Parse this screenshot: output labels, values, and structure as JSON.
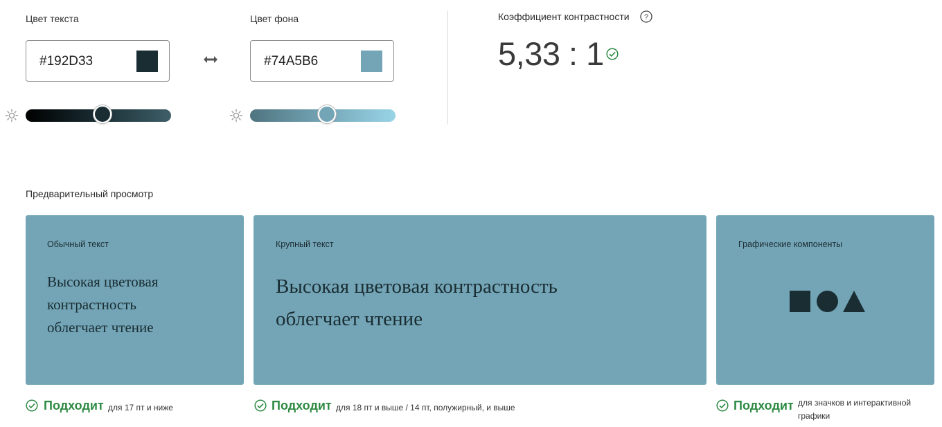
{
  "text_color": {
    "label": "Цвет текста",
    "value": "#192D33",
    "swatch": "#192D33",
    "brightness": 0.5
  },
  "swap_icon": "swap-horizontal-icon",
  "bg_color": {
    "label": "Цвет фона",
    "value": "#74A5B6",
    "swatch": "#74A5B6",
    "brightness": 0.53
  },
  "contrast": {
    "label": "Коэффициент контрастности",
    "ratio": "5,33 : 1",
    "status_color": "#2d8a43"
  },
  "preview": {
    "heading": "Предварительный просмотр",
    "normal": {
      "category": "Обычный текст",
      "line1": "Высокая цветовая",
      "line2": "контрастность",
      "line3": "облегчает чтение"
    },
    "large": {
      "category": "Крупный текст",
      "line1": "Высокая цветовая контрастность",
      "line2": "облегчает чтение"
    },
    "graphics": {
      "category": "Графические компоненты",
      "shapes": [
        "square-icon",
        "circle-icon",
        "triangle-icon"
      ]
    }
  },
  "results": {
    "normal": {
      "status": "Подходит",
      "note": "для 17 пт и ниже"
    },
    "large": {
      "status": "Подходит",
      "note": "для 18 пт и выше / 14 пт, полужирный, и выше"
    },
    "graphics": {
      "status": "Подходит",
      "note_line1": "для значков и интерактивной",
      "note_line2": "графики"
    }
  }
}
